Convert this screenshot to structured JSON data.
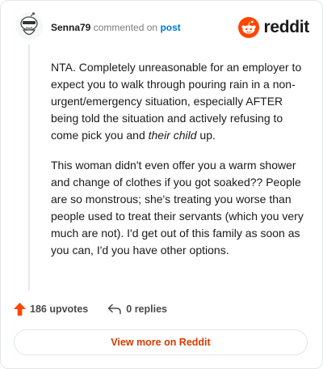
{
  "comment": {
    "author": "Senna79",
    "action_text": "commented on",
    "post_link_text": "post",
    "body_p1_before": "NTA. Completely unreasonable for an employer to expect you to walk through pouring rain in a non-urgent/emergency situation, especially AFTER being told the situation and actively refusing to come pick you and ",
    "body_p1_em": "their child",
    "body_p1_after": " up.",
    "body_p2": "This woman didn't even offer you a warm shower and change of clothes if you got soaked?? People are so monstrous; she's treating you worse than people used to treat their servants (which you very much are not). I'd get out of this family as soon as you can, I'd you have other options."
  },
  "brand": {
    "name": "reddit",
    "icon": "reddit-snoo-icon",
    "color": "#ff4500"
  },
  "actions": {
    "upvotes": "186 upvotes",
    "replies": "0 replies",
    "upvote_icon": "upvote-arrow-icon",
    "reply_icon": "reply-arrow-icon"
  },
  "footer": {
    "view_more_label": "View more on Reddit"
  },
  "colors": {
    "accent": "#ff4500",
    "link": "#0079d3",
    "button_text": "#d93a00"
  }
}
